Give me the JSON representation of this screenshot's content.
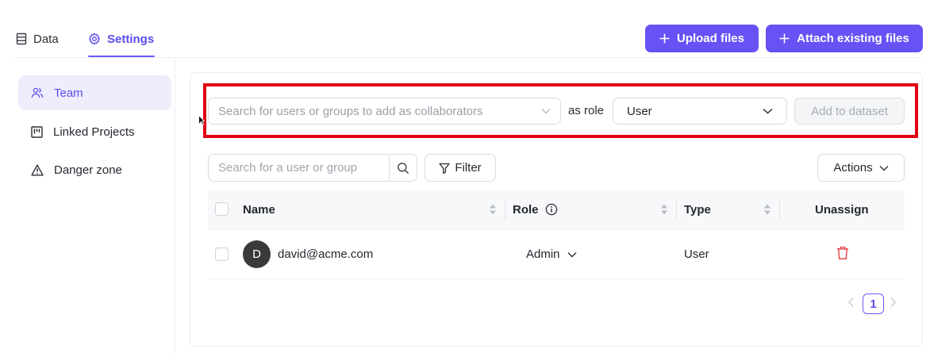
{
  "tabs": {
    "data": "Data",
    "settings": "Settings"
  },
  "actions": {
    "upload_files": "Upload files",
    "attach_existing_files": "Attach existing files"
  },
  "sidebar": {
    "items": [
      {
        "label": "Team",
        "icon": "users-icon",
        "active": true
      },
      {
        "label": "Linked Projects",
        "icon": "kanban-icon",
        "active": false
      },
      {
        "label": "Danger zone",
        "icon": "warning-icon",
        "active": false
      }
    ]
  },
  "add_collaborator": {
    "search_placeholder": "Search for users or groups to add as collaborators",
    "as_role": "as role",
    "role_value": "User",
    "add_button": "Add to dataset"
  },
  "toolbar": {
    "search_placeholder": "Search for a user or group",
    "filter": "Filter",
    "actions": "Actions"
  },
  "table": {
    "headers": {
      "name": "Name",
      "role": "Role",
      "type": "Type",
      "unassign": "Unassign"
    },
    "rows": [
      {
        "avatar": "D",
        "name": "david@acme.com",
        "role": "Admin",
        "type": "User"
      }
    ]
  },
  "pagination": {
    "current_page": "1"
  },
  "colors": {
    "accent": "#6652f5",
    "highlight": "#e00012",
    "delete": "#e5484d"
  }
}
